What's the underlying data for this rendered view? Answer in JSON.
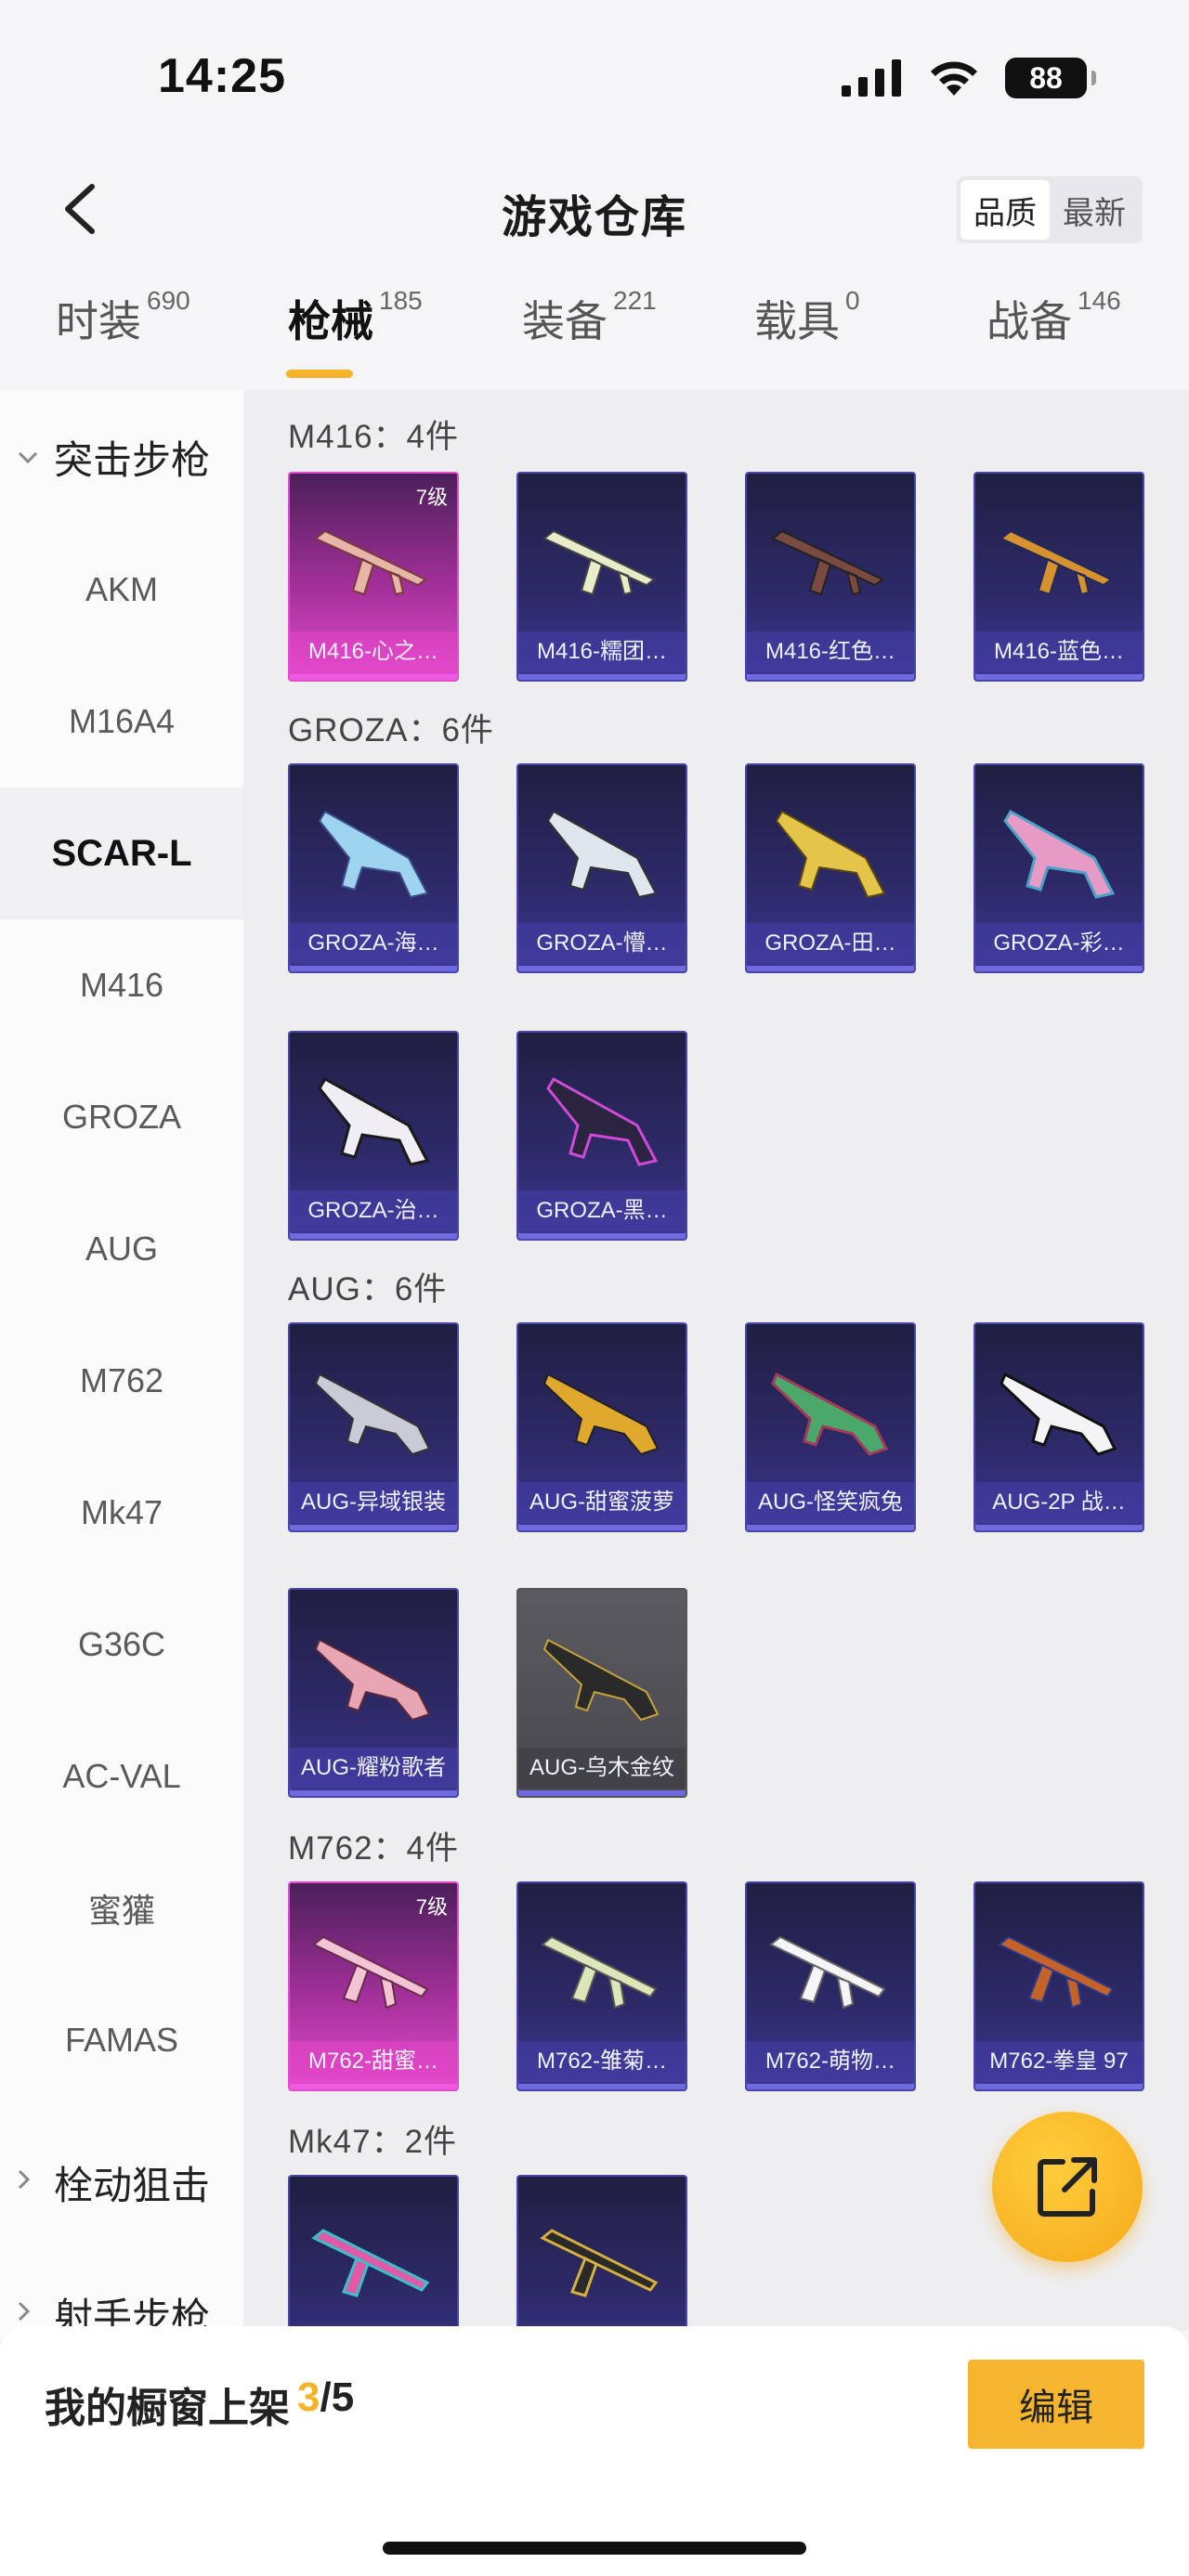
{
  "status": {
    "time": "14:25",
    "battery": "88"
  },
  "header": {
    "title": "游戏仓库",
    "sort_options": [
      "品质",
      "最新"
    ]
  },
  "tabs": [
    {
      "label": "时装",
      "count": "690"
    },
    {
      "label": "枪械",
      "count": "185"
    },
    {
      "label": "装备",
      "count": "221"
    },
    {
      "label": "载具",
      "count": "0"
    },
    {
      "label": "战备",
      "count": "146"
    }
  ],
  "sidebar": {
    "group1": "突击步枪",
    "items": [
      "AKM",
      "M16A4",
      "SCAR-L",
      "M416",
      "GROZA",
      "AUG",
      "M762",
      "Mk47",
      "G36C",
      "AC-VAL",
      "蜜獾",
      "FAMAS"
    ],
    "group2": "栓动狙击",
    "group3": "射手步枪"
  },
  "sections": [
    {
      "title": "M416：4件",
      "items": [
        {
          "name": "M416-心之…",
          "level": "7级"
        },
        {
          "name": "M416-糯团…"
        },
        {
          "name": "M416-红色…"
        },
        {
          "name": "M416-蓝色…"
        }
      ]
    },
    {
      "title": "GROZA：6件",
      "items": [
        {
          "name": "GROZA-海…"
        },
        {
          "name": "GROZA-懵…"
        },
        {
          "name": "GROZA-田…"
        },
        {
          "name": "GROZA-彩…"
        },
        {
          "name": "GROZA-治…"
        },
        {
          "name": "GROZA-黑…"
        }
      ]
    },
    {
      "title": "AUG：6件",
      "items": [
        {
          "name": "AUG-异域银装"
        },
        {
          "name": "AUG-甜蜜菠萝"
        },
        {
          "name": "AUG-怪笑疯兔"
        },
        {
          "name": "AUG-2P 战…"
        },
        {
          "name": "AUG-耀粉歌者"
        },
        {
          "name": "AUG-乌木金纹"
        }
      ]
    },
    {
      "title": "M762：4件",
      "items": [
        {
          "name": "M762-甜蜜…",
          "level": "7级"
        },
        {
          "name": "M762-雏菊…"
        },
        {
          "name": "M762-萌物…"
        },
        {
          "name": "M762-拳皇 97"
        }
      ]
    },
    {
      "title": "Mk47：2件",
      "items": [
        {
          "name": ""
        },
        {
          "name": ""
        }
      ]
    }
  ],
  "bottom": {
    "showcase_label": "我的橱窗上架",
    "showcase_count": "3",
    "showcase_total": "/5",
    "edit_label": "编辑"
  },
  "colors": {
    "accent": "#f5b32b",
    "card_blue": "#2e2a6a",
    "card_pink": "#e24ccd"
  }
}
